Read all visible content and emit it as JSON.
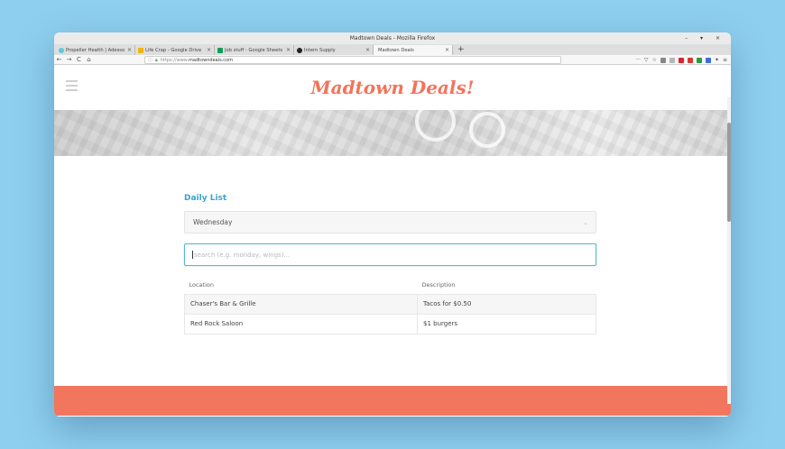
{
  "window": {
    "title": "Madtown Deals - Mozilla Firefox",
    "controls": "– ▾ ×"
  },
  "tabs": [
    {
      "label": "Propeller Health | Adesso",
      "color": "#5cc9e0"
    },
    {
      "label": "Life Crap - Google Drive",
      "color": "#f4b400"
    },
    {
      "label": "Job stuff - Google Sheets",
      "color": "#0f9d58"
    },
    {
      "label": "Intern Supply",
      "color": "#222222"
    },
    {
      "label": "Madtown Deals",
      "color": ""
    }
  ],
  "navbar": {
    "back": "←",
    "forward": "→",
    "reload": "C",
    "home": "⌂",
    "url_proto": "https://www.",
    "url_host": "madtowndeals.com",
    "menu": "···",
    "pocket": "▽",
    "star": "☆",
    "hamburger": "≡"
  },
  "site": {
    "title": "Madtown Deals!",
    "list_heading": "Daily List",
    "day_select": "Wednesday",
    "search_placeholder": "search (e.g. monday, wings)...",
    "table": {
      "headers": [
        "Location",
        "Description"
      ],
      "rows": [
        {
          "location": "Chaser's Bar & Grille",
          "description": "Tacos for $0.50"
        },
        {
          "location": "Red Rock Saloon",
          "description": "$1 burgers"
        }
      ]
    }
  },
  "colors": {
    "brand": "#f2745b",
    "accent": "#3aa3c8",
    "background": "#8ecfef"
  }
}
